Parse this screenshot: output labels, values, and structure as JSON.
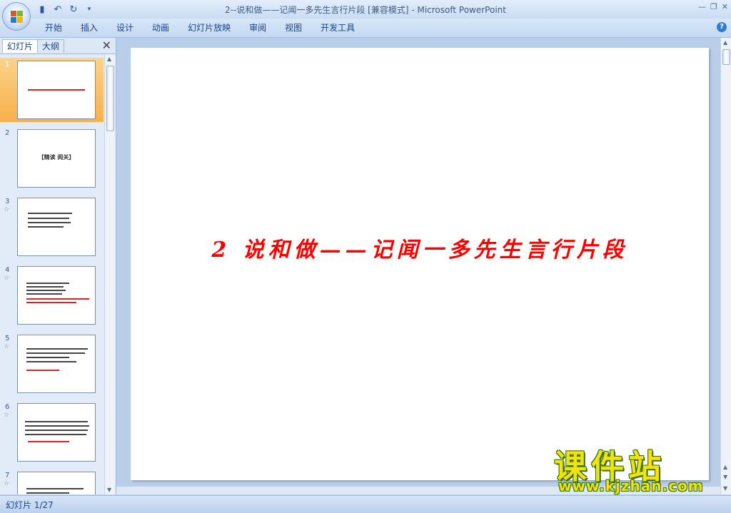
{
  "window": {
    "title": "2--说和做——记闻一多先生言行片段 [兼容模式] - Microsoft PowerPoint",
    "buttons": [
      "minimize-icon",
      "restore-icon",
      "close-icon"
    ]
  },
  "quick_access": [
    "save-icon",
    "undo-icon",
    "redo-icon",
    "customize-icon"
  ],
  "ribbon": {
    "tabs": [
      "开始",
      "插入",
      "设计",
      "动画",
      "幻灯片放映",
      "审阅",
      "视图",
      "开发工具"
    ],
    "help": "?"
  },
  "pane": {
    "tabs": [
      "幻灯片",
      "大纲"
    ],
    "close": "✕",
    "thumbnails": [
      {
        "number": "1",
        "selected": true,
        "has_star": false
      },
      {
        "number": "2",
        "selected": false,
        "has_star": false,
        "text": "【精读 阅关】"
      },
      {
        "number": "3",
        "selected": false,
        "has_star": true
      },
      {
        "number": "4",
        "selected": false,
        "has_star": true
      },
      {
        "number": "5",
        "selected": false,
        "has_star": true
      },
      {
        "number": "6",
        "selected": false,
        "has_star": true
      },
      {
        "number": "7",
        "selected": false,
        "has_star": true
      }
    ]
  },
  "slide": {
    "title": "2 说和做——记闻一多先生言行片段",
    "title_color": "#ff0000"
  },
  "statusbar": {
    "text": "幻灯片 1/27"
  },
  "watermark": {
    "main": "课件站",
    "url": "www.kjzhan.com"
  },
  "colors": {
    "accent": "#15428b",
    "selected_thumb": "#f7b04a"
  }
}
